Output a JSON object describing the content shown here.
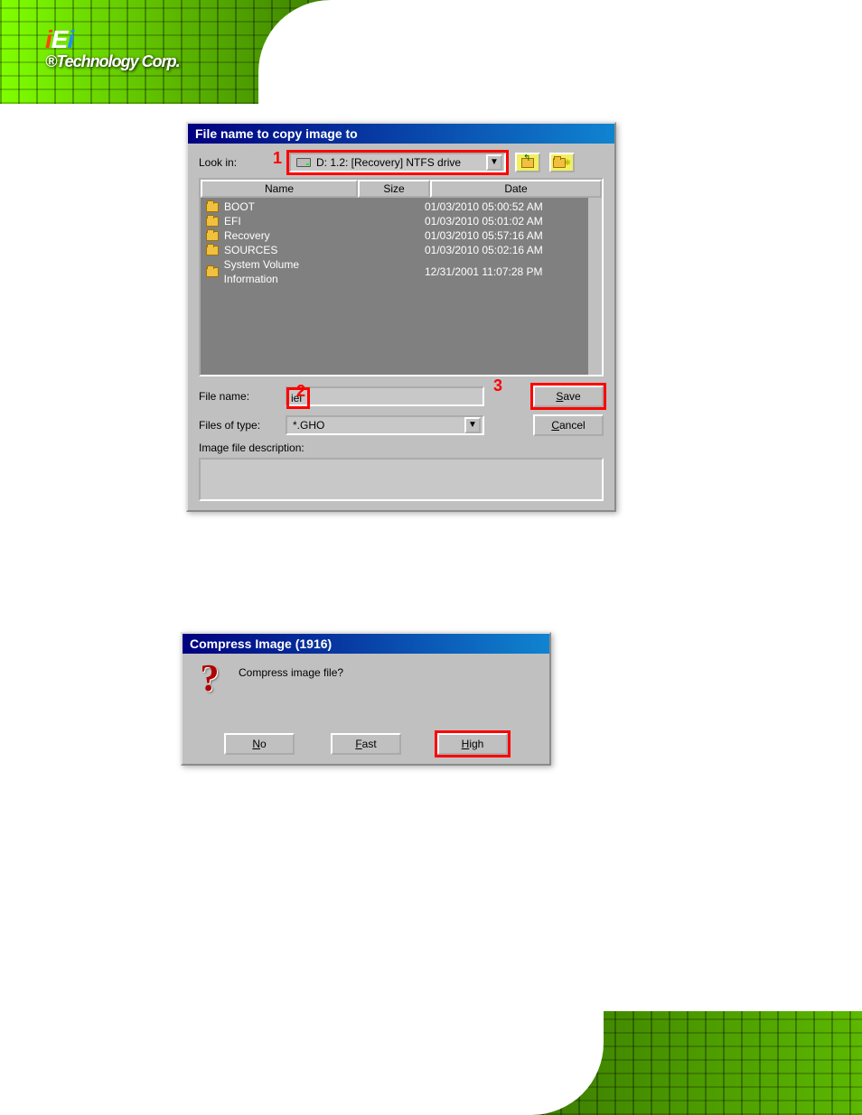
{
  "brand": {
    "reg": "®",
    "tech": "Technology Corp."
  },
  "dialog1": {
    "title": "File name to copy image to",
    "look_in_label": "Look in:",
    "look_in_value": "D: 1.2: [Recovery] NTFS drive",
    "headers": {
      "name": "Name",
      "size": "Size",
      "date": "Date"
    },
    "rows": [
      {
        "name": "BOOT",
        "size": "",
        "date": "01/03/2010 05:00:52 AM"
      },
      {
        "name": "EFI",
        "size": "",
        "date": "01/03/2010 05:01:02 AM"
      },
      {
        "name": "Recovery",
        "size": "",
        "date": "01/03/2010 05:57:16 AM"
      },
      {
        "name": "SOURCES",
        "size": "",
        "date": "01/03/2010 05:02:16 AM"
      },
      {
        "name": "System Volume Information",
        "size": "",
        "date": "12/31/2001 11:07:28 PM"
      }
    ],
    "file_name_label": "File name:",
    "file_name_value": "iei",
    "files_of_type_label": "Files of type:",
    "files_of_type_value": "*.GHO",
    "image_desc_label": "Image file description:",
    "save": "Save",
    "cancel": "Cancel",
    "callouts": {
      "c1": "1",
      "c2": "2",
      "c3": "3"
    }
  },
  "dialog2": {
    "title": "Compress Image (1916)",
    "prompt": "Compress image file?",
    "no": "No",
    "fast": "Fast",
    "high": "High"
  }
}
